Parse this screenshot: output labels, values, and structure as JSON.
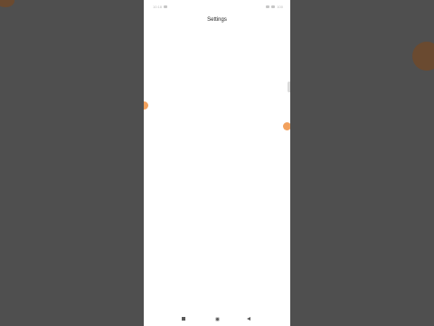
{
  "screen": {
    "title": "Settings"
  },
  "status_bar": {
    "time": "10:18",
    "battery": "100"
  },
  "nav_bar": {
    "recent_icon": "square-icon",
    "home_icon": "circle-icon",
    "back_icon": "triangle-back-icon"
  },
  "colors": {
    "backdrop": "#4f4f4f",
    "screen": "#ffffff",
    "accent_orange": "#f2a15d"
  }
}
